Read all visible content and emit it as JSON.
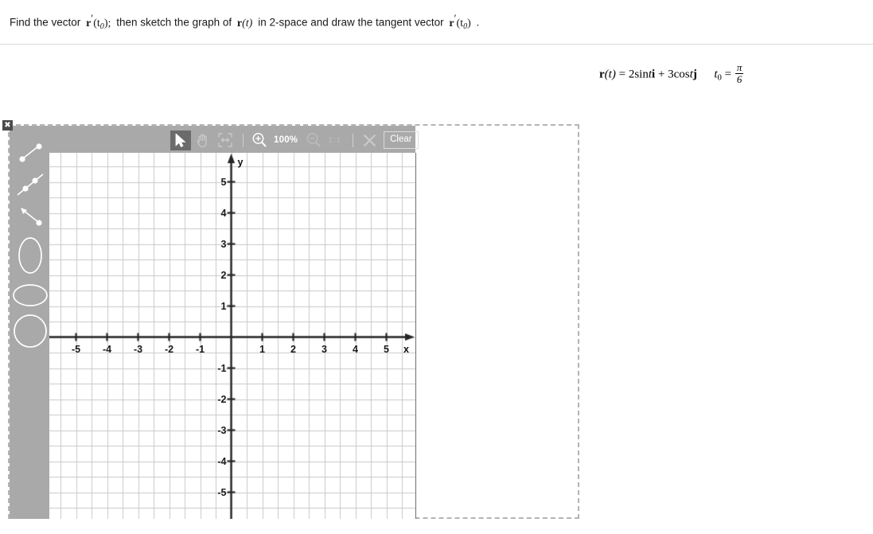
{
  "prompt": {
    "part1": "Find the vector",
    "expr1_vec": "r",
    "expr1_arg": "(t",
    "expr1_sub": "0",
    "expr1_close": ");",
    "part2": "then sketch the graph of",
    "expr2_vec": "r",
    "expr2_arg": "(t)",
    "part3": "in 2-space and draw the tangent vector",
    "expr3_vec": "r",
    "expr3_arg": "(t",
    "expr3_sub": "0",
    "expr3_close": ")",
    "period": "."
  },
  "equation": {
    "lhs_vec": "r",
    "lhs_arg": "(t)",
    "equals": "=",
    "term1_coef": "2",
    "term1_fn": "sin",
    "term1_var": "t",
    "term1_unit": "i",
    "plus": "+",
    "term2_coef": "3",
    "term2_fn": "cos",
    "term2_var": "t",
    "term2_unit": "j",
    "t0_var": "t",
    "t0_sub": "0",
    "t0_equals": "=",
    "t0_num": "π",
    "t0_den": "6"
  },
  "applet": {
    "close_label": "✖",
    "toolbar": {
      "select_icon": "cursor-arrow-icon",
      "pan_icon": "hand-icon",
      "fit_icon": "fit-to-screen-icon",
      "zoom_in_icon": "zoom-in-icon",
      "zoom_level": "100%",
      "zoom_out_icon": "zoom-out-icon",
      "actual_size_label": "1:1",
      "delete_icon": "x-cross-icon",
      "clear_label": "Clear"
    },
    "tools": [
      {
        "name": "line-segment-tool",
        "icon": "segment-icon"
      },
      {
        "name": "line-tool",
        "icon": "line-icon"
      },
      {
        "name": "vector-arrow-tool",
        "icon": "arrow-icon"
      },
      {
        "name": "vertical-ellipse-tool",
        "icon": "ellipse-vertical-icon"
      },
      {
        "name": "horizontal-ellipse-tool",
        "icon": "ellipse-horizontal-icon"
      },
      {
        "name": "circle-tool",
        "icon": "circle-icon"
      }
    ]
  },
  "chart_data": {
    "type": "scatter",
    "title": "",
    "xlabel": "x",
    "ylabel": "y",
    "xlim": [
      -5.9,
      5.9
    ],
    "ylim": [
      -5.9,
      5.9
    ],
    "x_ticks": [
      -5,
      -4,
      -3,
      -2,
      -1,
      1,
      2,
      3,
      4,
      5
    ],
    "y_ticks": [
      5,
      4,
      3,
      2,
      1,
      -1,
      -2,
      -3,
      -4,
      -5
    ],
    "x_tick_labels": [
      "-5",
      "-4",
      "-3",
      "-2",
      "-1",
      "1",
      "2",
      "3",
      "4",
      "5"
    ],
    "y_tick_labels": [
      "5",
      "4",
      "3",
      "2",
      "1",
      "-1",
      "-2",
      "-3",
      "-4",
      "-5"
    ],
    "grid": true,
    "grid_minor_step": 0.5,
    "legend": null,
    "series": [],
    "axis_color": "#262626",
    "grid_color": "#c9c9c9",
    "background": "#ffffff",
    "note": "Empty student graphing canvas; no data plotted."
  },
  "colors": {
    "chrome_gray": "#a9a9a9",
    "toolbar_selected": "#6b6b6b",
    "dashed_border": "#b4b4b4",
    "axis": "#262626",
    "grid": "#c9c9c9",
    "close_button": "#4b4b4b"
  }
}
